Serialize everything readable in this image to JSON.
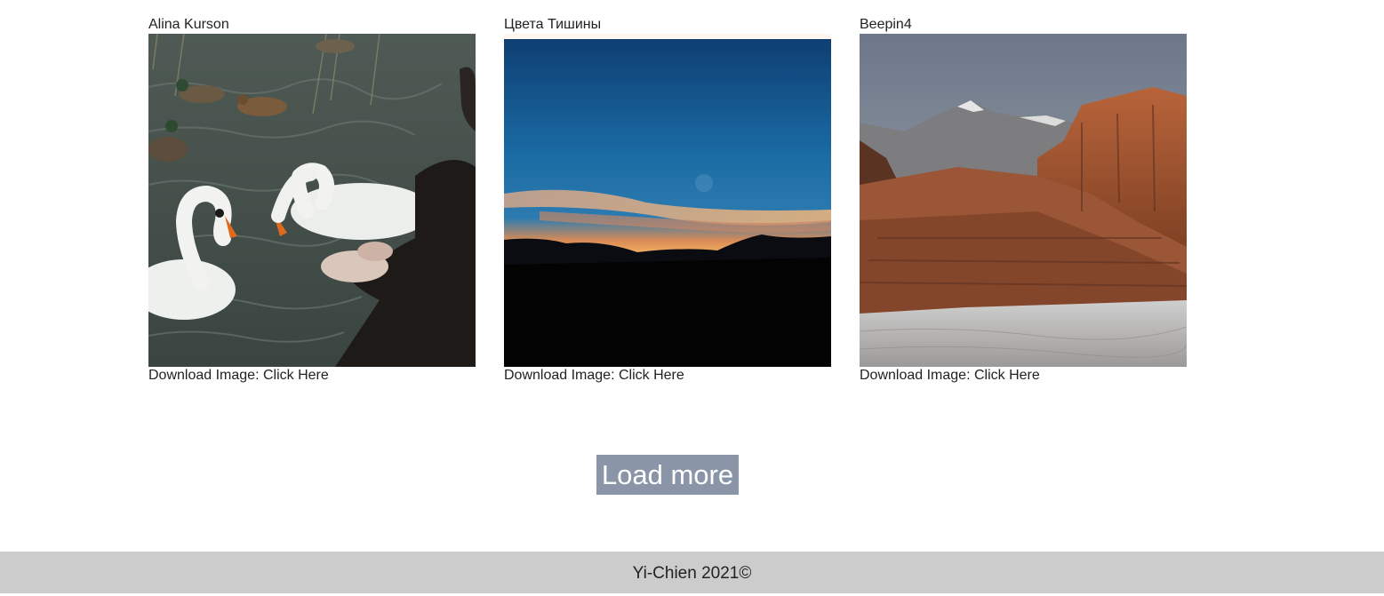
{
  "gallery": {
    "items": [
      {
        "author": "Alina Kurson",
        "download_label": "Download Image: Click Here"
      },
      {
        "author": "Цвета Тишины",
        "download_label": "Download Image: Click Here"
      },
      {
        "author": "Beepin4",
        "download_label": "Download Image: Click Here"
      }
    ]
  },
  "load_more_label": "Load more",
  "footer": {
    "text": "Yi-Chien 2021©"
  },
  "colors": {
    "button_bg": "#8a96a8",
    "footer_bg": "#cccccc"
  }
}
